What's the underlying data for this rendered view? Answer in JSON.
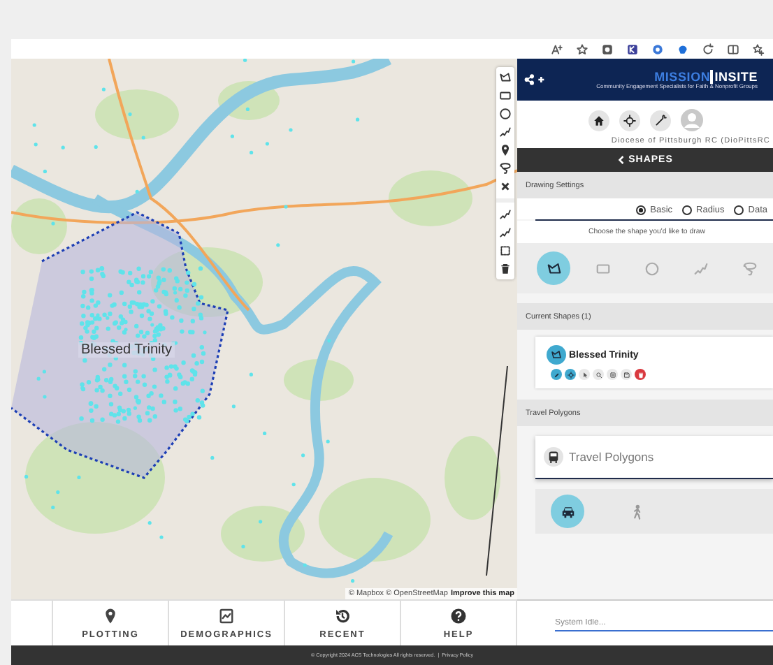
{
  "browser_toolbar": [
    {
      "kind": "reader"
    },
    {
      "kind": "star"
    },
    {
      "kind": "ext"
    },
    {
      "kind": "ext2"
    },
    {
      "kind": "ext3"
    },
    {
      "kind": "ext4"
    },
    {
      "kind": "refresh"
    },
    {
      "kind": "split"
    },
    {
      "kind": "favorites"
    }
  ],
  "map": {
    "shape_label": "Blessed Trinity",
    "attribution": "© Mapbox © OpenStreetMap",
    "attribution_link": "Improve this map"
  },
  "map_tools": [
    {
      "kind": "polygon"
    },
    {
      "kind": "rectangle"
    },
    {
      "kind": "circle"
    },
    {
      "kind": "line"
    },
    {
      "kind": "pin"
    },
    {
      "kind": "lasso"
    },
    {
      "kind": "close"
    },
    {
      "kind": "gap"
    },
    {
      "kind": "line"
    },
    {
      "kind": "line"
    },
    {
      "kind": "square"
    },
    {
      "kind": "trash"
    }
  ],
  "panel": {
    "logo_mission": "MISSION",
    "logo_insite": "INSITE",
    "logo_tagline": "Community Engagement Specialists for Faith & Nonprofit Groups",
    "nav": [
      {
        "kind": "home"
      },
      {
        "kind": "target"
      },
      {
        "kind": "wand"
      },
      {
        "kind": "avatar"
      }
    ],
    "account": "Diocese of Pittsburgh RC (DioPittsRC",
    "section_title": "SHAPES",
    "drawing_settings": {
      "title": "Drawing Settings",
      "modes": [
        {
          "label": "Basic",
          "selected": true
        },
        {
          "label": "Radius",
          "selected": false
        },
        {
          "label": "Data",
          "selected": false
        }
      ],
      "hint": "Choose the shape you'd like to draw",
      "shapes": [
        {
          "kind": "polygon",
          "selected": true
        },
        {
          "kind": "rectangle",
          "selected": false
        },
        {
          "kind": "circle",
          "selected": false
        },
        {
          "kind": "line",
          "selected": false
        },
        {
          "kind": "lasso",
          "selected": false
        }
      ]
    },
    "current_shapes": {
      "title": "Current Shapes (1)",
      "items": [
        {
          "name": "Blessed Trinity",
          "actions": [
            {
              "kind": "edit"
            },
            {
              "kind": "target"
            },
            {
              "kind": "cursor"
            },
            {
              "kind": "search"
            },
            {
              "kind": "list"
            },
            {
              "kind": "save"
            },
            {
              "kind": "delete"
            }
          ]
        }
      ]
    },
    "travel_polygons": {
      "title": "Travel Polygons",
      "card_title": "Travel Polygons",
      "modes": [
        {
          "kind": "car",
          "selected": true
        },
        {
          "kind": "walk",
          "selected": false
        }
      ]
    },
    "status": {
      "placeholder": "System Idle..."
    }
  },
  "bottom_nav": [
    {
      "label": "PLOTTING",
      "kind": "pin"
    },
    {
      "label": "DEMOGRAPHICS",
      "kind": "chart"
    },
    {
      "label": "RECENT",
      "kind": "history"
    },
    {
      "label": "HELP",
      "kind": "help"
    }
  ],
  "footer": {
    "copyright": "© Copyright 2024 ACS Technologies All rights reserved.",
    "separator": "|",
    "link": "Privacy Policy"
  }
}
